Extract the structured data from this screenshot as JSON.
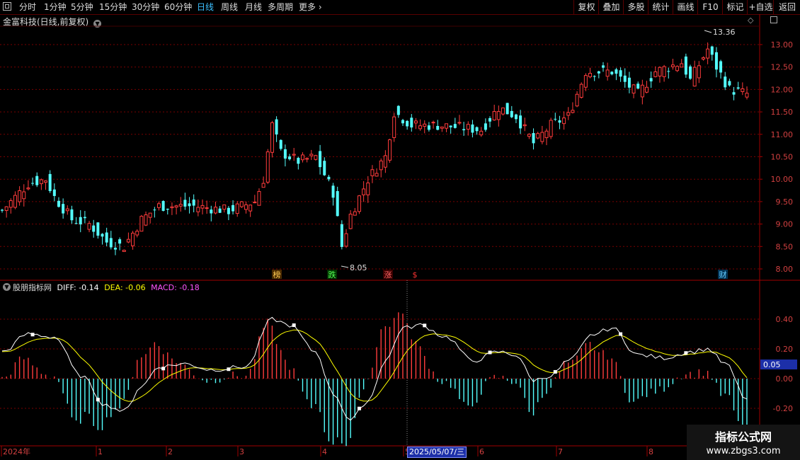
{
  "toolbar": {
    "periods": [
      "分时",
      "1分钟",
      "5分钟",
      "15分钟",
      "30分钟",
      "60分钟",
      "日线",
      "周线",
      "月线",
      "多周期",
      "更多"
    ],
    "active": "日线",
    "right": [
      "复权",
      "叠加",
      "多股",
      "统计",
      "画线",
      "F10",
      "标记",
      "+自选",
      "返回"
    ]
  },
  "main": {
    "title": "金富科技(日线,前复权)",
    "price_ticks": [
      "13.00",
      "12.50",
      "12.00",
      "11.50",
      "11.00",
      "10.50",
      "10.00",
      "9.50",
      "9.00",
      "8.50",
      "8.00"
    ],
    "high_label": "13.36",
    "low_label": "8.05",
    "markers": [
      {
        "text": "榜",
        "color": "#ffcc55",
        "bg": "#4a2a00"
      },
      {
        "text": "跌",
        "color": "#55ff55",
        "bg": "#003300"
      },
      {
        "text": "涨",
        "color": "#ff6666",
        "bg": "#3a0000"
      },
      {
        "text": "$",
        "color": "#ff3333",
        "bg": "none"
      },
      {
        "text": "财",
        "color": "#66ccff",
        "bg": "#003355"
      }
    ]
  },
  "indicator": {
    "name": "股朋指标网",
    "diff_label": "DIFF: -0.14",
    "dea_label": "DEA: -0.06",
    "macd_label": "MACD: -0.18",
    "ticks": [
      "0.40",
      "0.20",
      "0.00",
      "-0.20"
    ],
    "current_value": "0.05",
    "colors": {
      "diff": "#ffffff",
      "dea": "#ffff00",
      "macd": "#ff55ff"
    }
  },
  "time_axis": {
    "labels": [
      "2024年",
      "1",
      "2",
      "3",
      "4",
      "5",
      "6",
      "7",
      "8"
    ],
    "selected_date": "2025/05/07/三"
  },
  "watermark": {
    "line1": "指标公式网",
    "line2": "www.zbgs3.com"
  }
}
